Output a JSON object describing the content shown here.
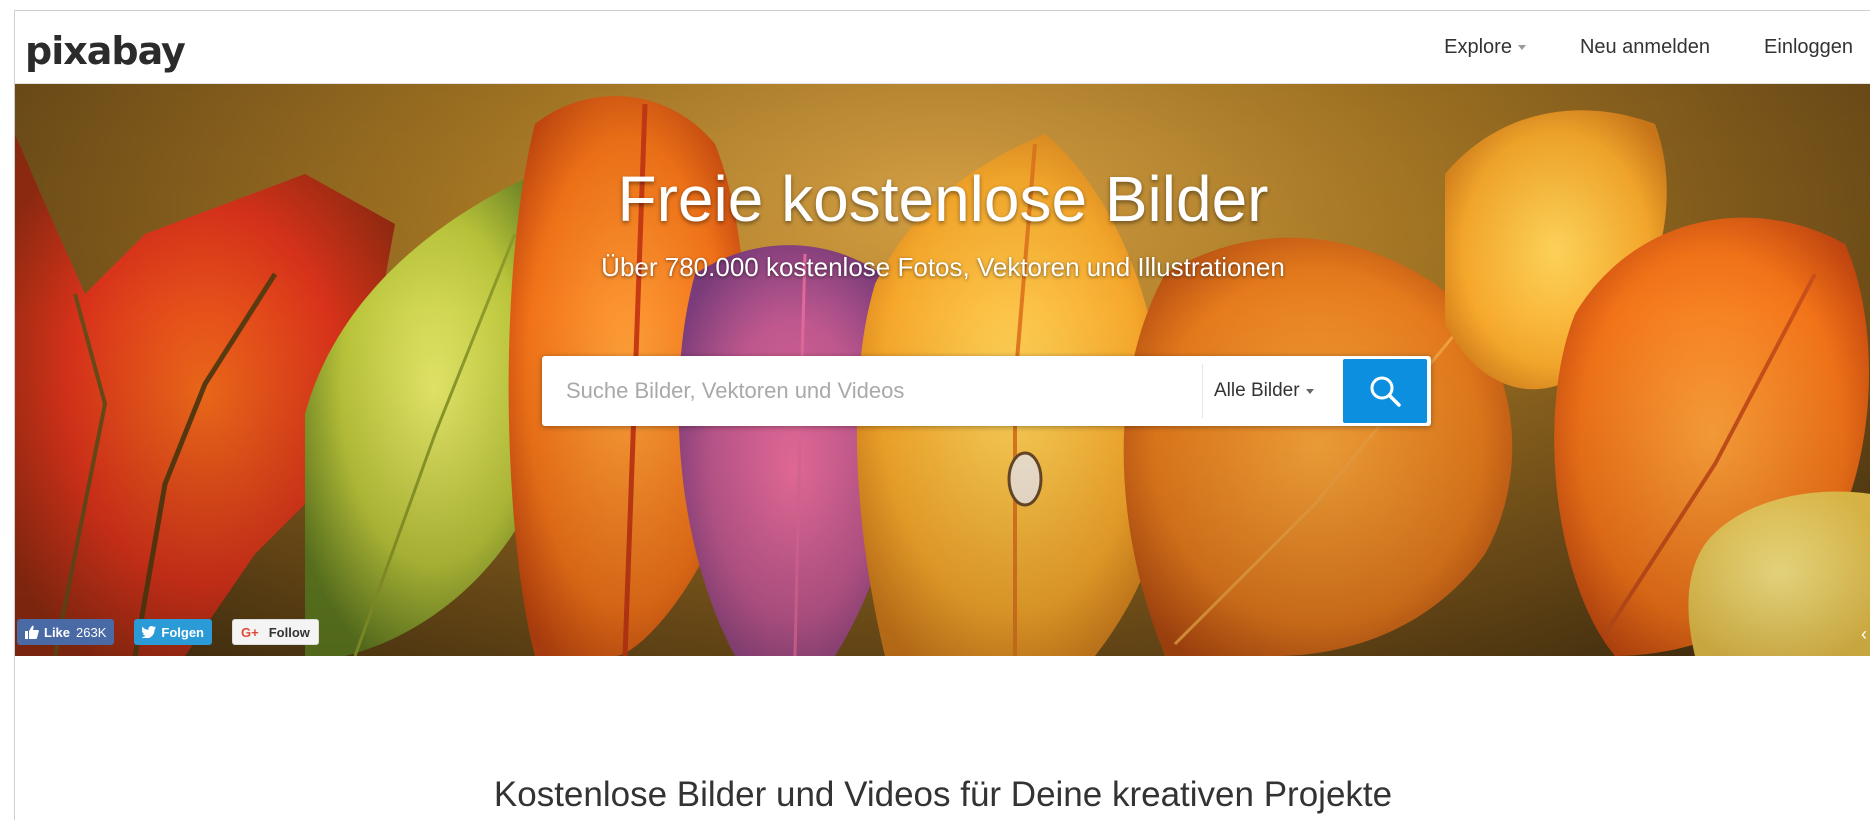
{
  "header": {
    "logo": "pixabay",
    "nav": {
      "explore": "Explore",
      "signup": "Neu anmelden",
      "login": "Einloggen"
    }
  },
  "hero": {
    "title": "Freie kostenlose Bilder",
    "subtitle": "Über 780.000 kostenlose Fotos, Vektoren und Illustrationen",
    "search": {
      "placeholder": "Suche Bilder, Vektoren und Videos",
      "value": "",
      "filter_label": "Alle Bilder"
    },
    "social": {
      "facebook_label": "Like",
      "facebook_count": "263K",
      "twitter_label": "Folgen",
      "google_label": "Follow"
    }
  },
  "tagline": "Kostenlose Bilder und Videos für Deine kreativen Projekte",
  "colors": {
    "search_button": "#0d8fe0",
    "facebook": "#4a6aa5",
    "twitter": "#2b9bd8"
  },
  "icons": {
    "search": "search-icon",
    "thumbs_up": "thumbs-up-icon",
    "twitter": "twitter-bird-icon",
    "google_plus": "google-plus-icon",
    "caret": "caret-down-icon",
    "next": "chevron-right-icon"
  }
}
